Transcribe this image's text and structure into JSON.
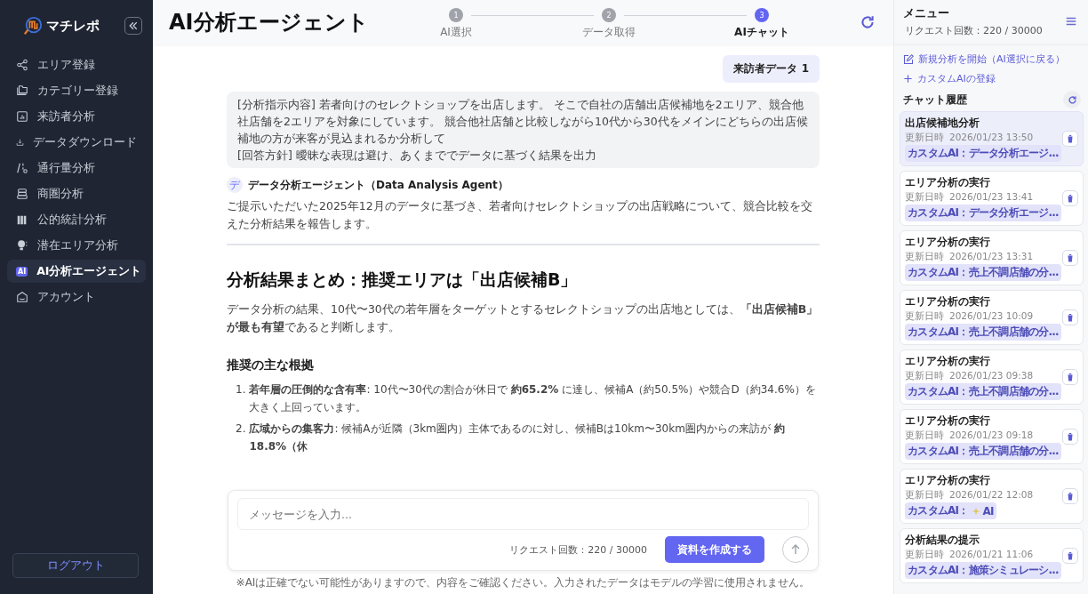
{
  "sidebar": {
    "brand": "マチレポ",
    "nav": [
      {
        "label": "エリア登録",
        "selected": false
      },
      {
        "label": "カテゴリー登録",
        "selected": false
      },
      {
        "label": "来訪者分析",
        "selected": false
      },
      {
        "label": "データダウンロード",
        "selected": false
      },
      {
        "label": "通行量分析",
        "selected": false
      },
      {
        "label": "商圏分析",
        "selected": false
      },
      {
        "label": "公的統計分析",
        "selected": false
      },
      {
        "label": "潜在エリア分析",
        "selected": false
      },
      {
        "label": "AI分析エージェント",
        "icon_text": "AI",
        "selected": true
      },
      {
        "label": "アカウント",
        "selected": false
      }
    ],
    "logout": "ログアウト"
  },
  "header": {
    "title": "AI分析エージェント",
    "steps": [
      {
        "number": "1",
        "label": "AI選択",
        "selected": false
      },
      {
        "number": "2",
        "label": "データ取得",
        "selected": false
      },
      {
        "number": "3",
        "label": "AIチャット",
        "selected": true
      }
    ]
  },
  "chat": {
    "data_chip": "来訪者データ 1",
    "prompt": [
      "[分析指示内容] 若者向けのセレクトショップを出店します。 そこで自社の店舗出店候補地を2エリア、競合他社店舗を2エリアを対象にしています。 競合他社店舗と比較しながら10代から30代をメインにどちらの出店候補地の方が来客が見込まれるか分析して",
      "[回答方針] 曖昧な表現は避け、あくまででデータに基づく結果を出力"
    ],
    "agent_avatar": "デ",
    "agent_name": "データ分析エージェント（Data Analysis Agent）",
    "intro": "ご提示いただいた2025年12月のデータに基づき、若者向けセレクトショップの出店戦略について、競合比較を交えた分析結果を報告します。",
    "heading": "分析結果まとめ：推奨エリアは「出店候補B」",
    "summary": "データ分析の結果、10代〜30代の若年層をターゲットとするセレクトショップの出店地としては、**「出店候補B」が最も有望**であると判断します。",
    "subheading": "推奨の主な根拠",
    "reasons": [
      {
        "number": "1.",
        "text": "**若年層の圧倒的な含有率**: 10代〜30代の割合が休日で **約65.2%** に達し、候補A（約50.5%）や競合D（約34.6%）を大きく上回っています。"
      },
      {
        "number": "2.",
        "text": "**広域からの集客力**: 候補Aが近隣（3km圏内）主体であるのに対し、候補Bは10km〜30km圏内からの来訪が **約18.8%（休**"
      }
    ],
    "input_placeholder": "メッセージを入力...",
    "request_count": "リクエスト回数：220 / 30000",
    "create_button": "資料を作成する",
    "disclaimer": "※AIは正確でない可能性がありますので、内容をご確認ください。入力されたデータはモデルの学習に使用されません。"
  },
  "menu": {
    "title": "メニュー",
    "request_count": "リクエスト回数：220 / 30000",
    "actions": [
      "新規分析を開始（AI選択に戻る）",
      "カスタムAIの登録"
    ],
    "history_title": "チャット履歴",
    "history": [
      {
        "title": "出店候補地分析",
        "date_label": "更新日時",
        "date": "2026/01/23 13:50",
        "tag": "カスタムAI：データ分析エージ...",
        "selected": true
      },
      {
        "title": "エリア分析の実行",
        "date_label": "更新日時",
        "date": "2026/01/23 13:41",
        "tag": "カスタムAI：データ分析エージ...",
        "selected": false
      },
      {
        "title": "エリア分析の実行",
        "date_label": "更新日時",
        "date": "2026/01/23 13:31",
        "tag": "カスタムAI：売上不調店舗の分...",
        "selected": false
      },
      {
        "title": "エリア分析の実行",
        "date_label": "更新日時",
        "date": "2026/01/23 10:09",
        "tag": "カスタムAI：売上不調店舗の分...",
        "selected": false
      },
      {
        "title": "エリア分析の実行",
        "date_label": "更新日時",
        "date": "2026/01/23 09:38",
        "tag": "カスタムAI：売上不調店舗の分...",
        "selected": false
      },
      {
        "title": "エリア分析の実行",
        "date_label": "更新日時",
        "date": "2026/01/23 09:18",
        "tag": "カスタムAI：売上不調店舗の分...",
        "selected": false
      },
      {
        "title": "エリア分析の実行",
        "date_label": "更新日時",
        "date": "2026/01/22 12:08",
        "tag": "カスタムAI：",
        "tag_icon": true,
        "tag_after": "AI",
        "selected": false
      },
      {
        "title": "分析結果の提示",
        "date_label": "更新日時",
        "date": "2026/01/21 11:06",
        "tag": "カスタムAI：施策シミュレーシ...",
        "selected": false
      }
    ]
  }
}
